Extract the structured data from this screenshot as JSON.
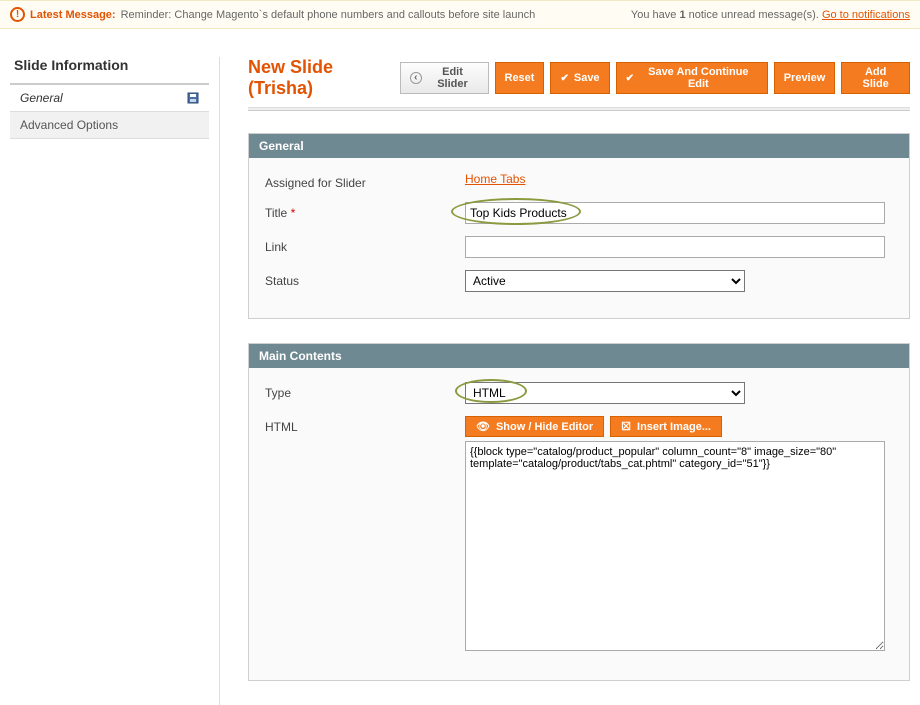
{
  "notice": {
    "label": "Latest Message:",
    "message": "Reminder: Change Magento`s default phone numbers and callouts before site launch",
    "right_prefix": "You have ",
    "right_count": "1",
    "right_suffix": " notice unread message(s). ",
    "link": "Go to notifications"
  },
  "sidebar": {
    "title": "Slide Information",
    "items": [
      {
        "label": "General",
        "active": true
      },
      {
        "label": "Advanced Options",
        "active": false
      }
    ]
  },
  "page": {
    "title": "New Slide (Trisha)"
  },
  "buttons": {
    "edit_slider": "Edit Slider",
    "reset": "Reset",
    "save": "Save",
    "save_continue": "Save And Continue Edit",
    "preview": "Preview",
    "add_slide": "Add Slide"
  },
  "general": {
    "heading": "General",
    "labels": {
      "assigned": "Assigned for Slider",
      "title": "Title",
      "link": "Link",
      "status": "Status"
    },
    "assigned_value": "Home Tabs",
    "title_value": "Top Kids Products",
    "link_value": "",
    "status_value": "Active"
  },
  "main_contents": {
    "heading": "Main Contents",
    "labels": {
      "type": "Type",
      "html": "HTML"
    },
    "type_value": "HTML",
    "show_hide": "Show / Hide Editor",
    "insert_image": "Insert Image...",
    "html_value": "{{block type=\"catalog/product_popular\" column_count=\"8\" image_size=\"80\" template=\"catalog/product/tabs_cat.phtml\" category_id=\"51\"}}"
  }
}
